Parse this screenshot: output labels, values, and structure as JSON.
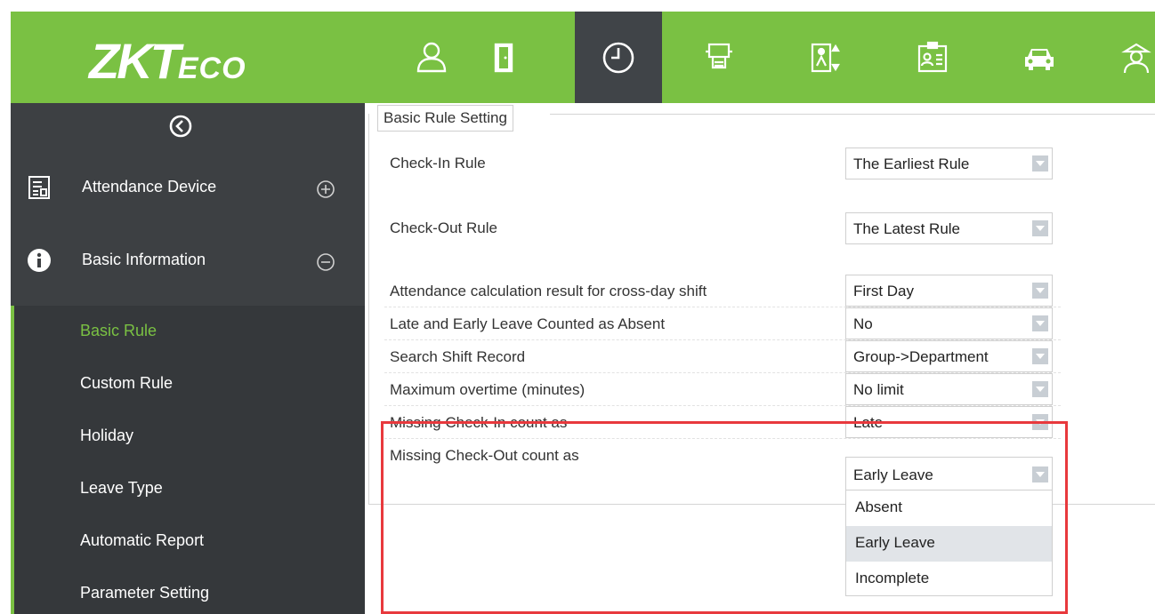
{
  "app": {
    "logo_main": "ZKT",
    "logo_sub": "ECO"
  },
  "nav": {
    "icons": [
      "person-icon",
      "door-icon",
      "clock-icon",
      "consumption-icon",
      "elevator-icon",
      "visitor-badge-icon",
      "car-icon",
      "guard-icon"
    ],
    "active": "clock-icon"
  },
  "sidebar": {
    "groups": [
      {
        "label": "Attendance Device",
        "icon": "device-icon",
        "toggle": "expand"
      },
      {
        "label": "Basic Information",
        "icon": "info-icon",
        "toggle": "collapse"
      }
    ],
    "items": [
      {
        "label": "Basic Rule",
        "active": true
      },
      {
        "label": "Custom Rule",
        "active": false
      },
      {
        "label": "Holiday",
        "active": false
      },
      {
        "label": "Leave Type",
        "active": false
      },
      {
        "label": "Automatic Report",
        "active": false
      },
      {
        "label": "Parameter Setting",
        "active": false
      }
    ]
  },
  "main": {
    "legend": "Basic Rule Setting",
    "rows": [
      {
        "label": "Check-In Rule",
        "value": "The Earliest Rule"
      },
      {
        "label": "Check-Out Rule",
        "value": "The Latest Rule"
      },
      {
        "label": "Attendance calculation result for cross-day shift",
        "value": "First Day"
      },
      {
        "label": "Late and Early Leave Counted as Absent",
        "value": "No"
      },
      {
        "label": "Search Shift Record",
        "value": "Group->Department"
      },
      {
        "label": "Maximum overtime (minutes)",
        "value": "No limit"
      },
      {
        "label": "Missing Check-In count as",
        "value": "Late"
      },
      {
        "label": "Missing Check-Out count as",
        "value": "Early Leave"
      }
    ],
    "dropdown": {
      "options": [
        "Absent",
        "Early Leave",
        "Incomplete"
      ],
      "hovered": "Early Leave"
    }
  },
  "colors": {
    "brand_green": "#7ac143",
    "sidebar_bg": "#3d4043",
    "active_nav": "#404448",
    "highlight_red": "#e8393d"
  }
}
